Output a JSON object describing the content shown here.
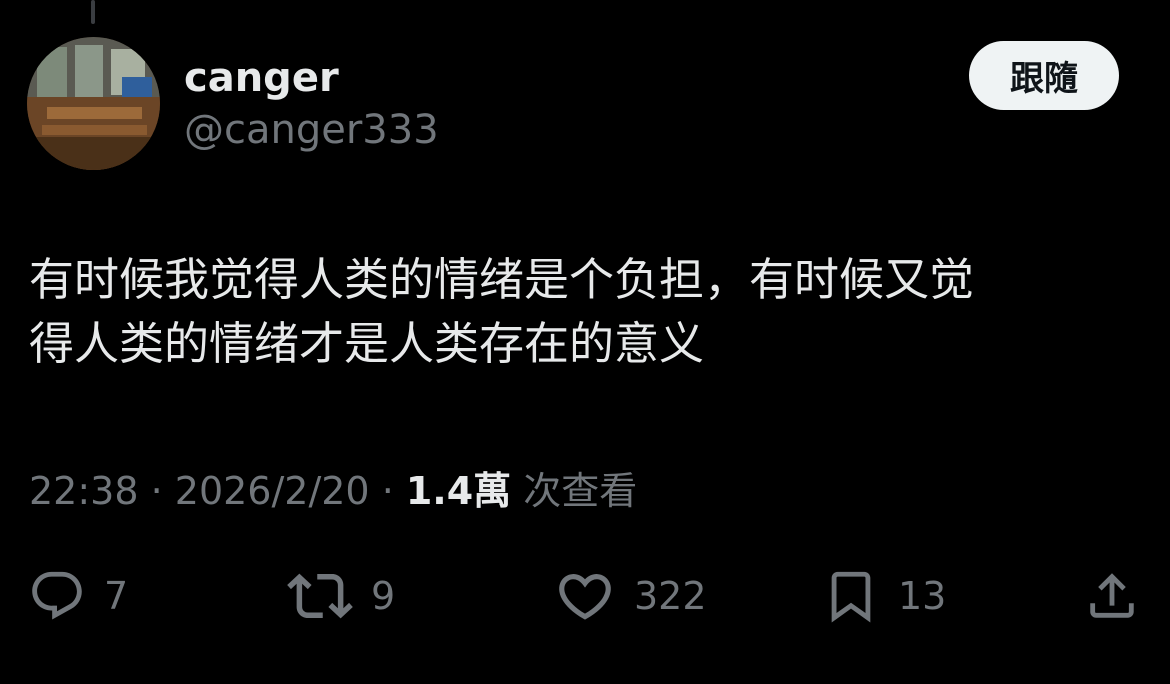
{
  "author": {
    "display_name": "canger",
    "handle": "@canger333"
  },
  "follow_label": "跟隨",
  "post": {
    "line1": "有时候我觉得人类的情绪是个负担，有时候又觉",
    "line2": "得人类的情绪才是人类存在的意义"
  },
  "meta": {
    "time": "22:38",
    "separator": " · ",
    "date": "2026/2/20",
    "views_count": "1.4萬",
    "views_label": " 次查看"
  },
  "actions": {
    "replies": "7",
    "reposts": "9",
    "likes": "322",
    "bookmarks": "13"
  },
  "icons": {
    "reply": "reply-icon",
    "repost": "repost-icon",
    "like": "heart-icon",
    "bookmark": "bookmark-icon",
    "share": "share-icon"
  },
  "colors": {
    "background": "#000000",
    "primary_text": "#e7e9ea",
    "secondary_text": "#71767b",
    "follow_button_bg": "#eff3f4",
    "follow_button_text": "#0f1419"
  }
}
